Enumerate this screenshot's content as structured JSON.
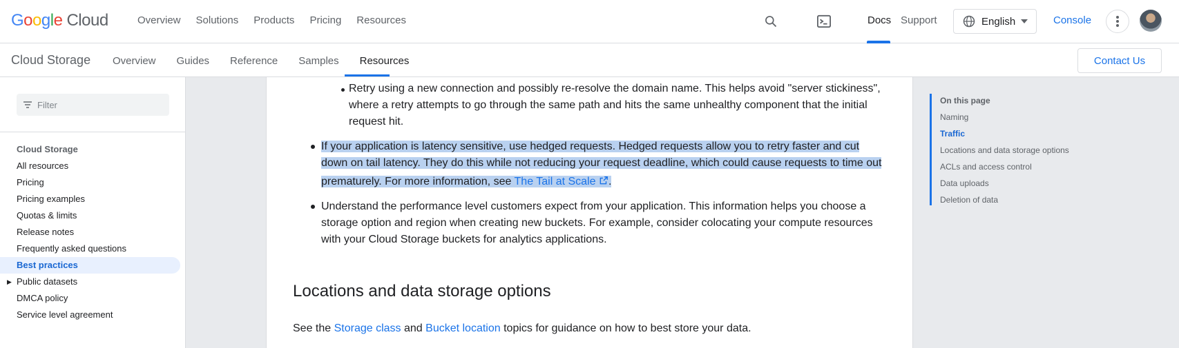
{
  "header": {
    "brand_letters": [
      "G",
      "o",
      "o",
      "g",
      "l",
      "e"
    ],
    "brand_suffix": "Cloud",
    "nav": [
      "Overview",
      "Solutions",
      "Products",
      "Pricing",
      "Resources"
    ],
    "docs_label": "Docs",
    "support_label": "Support",
    "language": "English",
    "console_label": "Console"
  },
  "subheader": {
    "product": "Cloud Storage",
    "tabs": [
      "Overview",
      "Guides",
      "Reference",
      "Samples",
      "Resources"
    ],
    "active_tab": "Resources",
    "contact_label": "Contact Us"
  },
  "sidebar": {
    "filter_placeholder": "Filter",
    "items": [
      {
        "label": "Cloud Storage",
        "kind": "head"
      },
      {
        "label": "All resources"
      },
      {
        "label": "Pricing"
      },
      {
        "label": "Pricing examples"
      },
      {
        "label": "Quotas & limits"
      },
      {
        "label": "Release notes"
      },
      {
        "label": "Frequently asked questions"
      },
      {
        "label": "Best practices",
        "kind": "active"
      },
      {
        "label": "Public datasets",
        "kind": "expandable"
      },
      {
        "label": "DMCA policy"
      },
      {
        "label": "Service level agreement"
      }
    ]
  },
  "article": {
    "sub_bullet": [
      "Retry using a new connection and possibly re-resolve the domain name. This helps avoid \"server stickiness\",",
      "where a retry attempts to go through the same path and hits the same unhealthy component that the initial",
      "request hit."
    ],
    "hedged": [
      "If your application is latency sensitive, use hedged requests. Hedged requests allow you to retry faster and cut",
      "down on tail latency. They do this while not reducing your request deadline, which could cause requests to time out",
      "prematurely. For more information, see "
    ],
    "hedged_link": "The Tail at Scale",
    "hedged_end": ".",
    "perf": [
      "Understand the performance level customers expect from your application. This information helps you choose a",
      "storage option and region when creating new buckets. For example, consider colocating your compute resources",
      "with your Cloud Storage buckets for analytics applications."
    ],
    "heading": "Locations and data storage options",
    "see_prefix": "See the ",
    "link1": "Storage class",
    "and": " and ",
    "link2": "Bucket location",
    "see_suffix": " topics for guidance on how to best store your data."
  },
  "toc": {
    "title": "On this page",
    "items": [
      "Naming",
      "Traffic",
      "Locations and data storage options",
      "ACLs and access control",
      "Data uploads",
      "Deletion of data"
    ],
    "active": "Traffic"
  }
}
